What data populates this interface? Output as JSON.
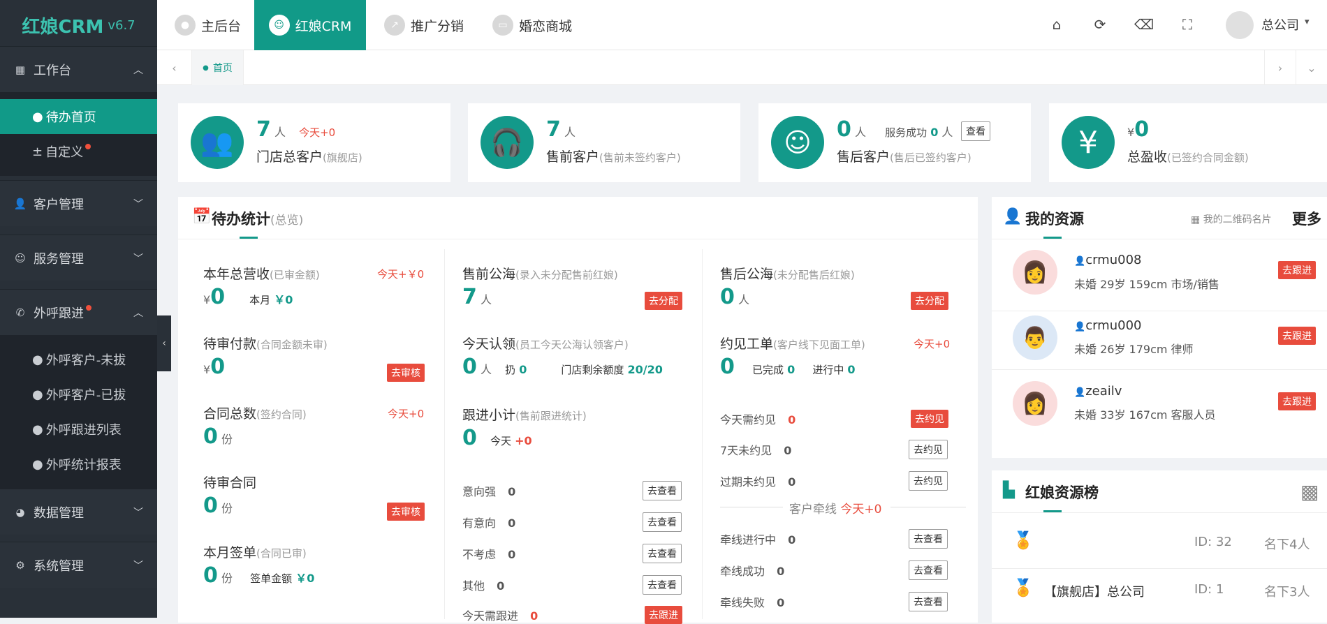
{
  "app": {
    "name": "红娘CRM",
    "version": "v6.7"
  },
  "sidebar": {
    "workbench": "工作台",
    "workbench_items": [
      "待办首页",
      "自定义"
    ],
    "customer": "客户管理",
    "service": "服务管理",
    "outcall": "外呼跟进",
    "outcall_items": [
      "外呼客户-未拔",
      "外呼客户-已拔",
      "外呼跟进列表",
      "外呼统计报表"
    ],
    "data": "数据管理",
    "system": "系统管理"
  },
  "topnav": {
    "tabs": [
      "主后台",
      "红娘CRM",
      "推广分销",
      "婚恋商城"
    ],
    "user": "总公司"
  },
  "tabstrip": {
    "home": "首页"
  },
  "kpi": [
    {
      "value": "7",
      "unit": "人",
      "today": "今天+0",
      "label": "门店总客户",
      "sub": "(旗舰店)"
    },
    {
      "value": "7",
      "unit": "人",
      "label": "售前客户",
      "sub": "(售前未签约客户)"
    },
    {
      "value": "0",
      "unit": "人",
      "success": "服务成功",
      "success_val": "0",
      "success_unit": "人",
      "btn": "查看",
      "label": "售后客户",
      "sub": "(售后已签约客户)"
    },
    {
      "currency": "¥",
      "value": "0",
      "label": "总盈收",
      "sub": "(已签约合同金额)"
    }
  ],
  "todo": {
    "title": "待办统计",
    "sub": "(总览)",
    "col1": {
      "revenue": {
        "label": "本年总营收",
        "sub": "(已审金额)",
        "today": "今天+￥0",
        "cur": "¥",
        "value": "0",
        "month": "本月",
        "month_val": "￥0"
      },
      "pending_pay": {
        "label": "待审付款",
        "sub": "(合同金额未审)",
        "cur": "¥",
        "value": "0",
        "btn": "去审核"
      },
      "contracts": {
        "label": "合同总数",
        "sub": "(签约合同)",
        "today": "今天+0",
        "value": "0",
        "unit": "份"
      },
      "pending_contract": {
        "label": "待审合同",
        "value": "0",
        "unit": "份",
        "btn": "去审核"
      },
      "month_sign": {
        "label": "本月签单",
        "sub": "(合同已审)",
        "value": "0",
        "unit": "份",
        "amount_label": "签单金额",
        "amount": "￥0"
      }
    },
    "col2": {
      "presale_sea": {
        "label": "售前公海",
        "sub": "(录入未分配售前红娘)",
        "value": "7",
        "unit": "人",
        "btn": "去分配"
      },
      "claim": {
        "label": "今天认领",
        "sub": "(员工今天公海认领客户)",
        "value": "0",
        "unit": "人",
        "reng": "扔",
        "reng_val": "0",
        "quota_label": "门店剩余额度",
        "quota": "20/20"
      },
      "follow": {
        "label": "跟进小计",
        "sub": "(售前跟进统计)",
        "value": "0",
        "today": "今天",
        "today_val": "+0"
      },
      "rows": [
        {
          "l": "意向强",
          "v": "0",
          "b": "去查看"
        },
        {
          "l": "有意向",
          "v": "0",
          "b": "去查看"
        },
        {
          "l": "不考虑",
          "v": "0",
          "b": "去查看"
        },
        {
          "l": "其他",
          "v": "0",
          "b": "去查看"
        }
      ],
      "need": {
        "l": "今天需跟进",
        "v": "0",
        "b": "去跟进"
      }
    },
    "col3": {
      "aftersale_sea": {
        "label": "售后公海",
        "sub": "(未分配售后红娘)",
        "value": "0",
        "unit": "人",
        "btn": "去分配"
      },
      "meet": {
        "label": "约见工单",
        "sub": "(客户线下见面工单)",
        "today": "今天+0",
        "value": "0",
        "done": "已完成",
        "done_val": "0",
        "ing": "进行中",
        "ing_val": "0"
      },
      "rows": [
        {
          "l": "今天需约见",
          "v": "0",
          "b": "去约见"
        },
        {
          "l": "7天未约见",
          "v": "0",
          "b": "去约见"
        },
        {
          "l": "过期未约见",
          "v": "0",
          "b": "去约见"
        }
      ],
      "divider": "客户牵线",
      "divider_today": "今天+0",
      "rows2": [
        {
          "l": "牵线进行中",
          "v": "0",
          "b": "去查看"
        },
        {
          "l": "牵线成功",
          "v": "0",
          "b": "去查看"
        },
        {
          "l": "牵线失败",
          "v": "0",
          "b": "去查看"
        }
      ]
    }
  },
  "resources": {
    "title": "我的资源",
    "qrcode": "我的二维码名片",
    "more": "更多",
    "items": [
      {
        "name": "crmu008",
        "info": "未婚 29岁 159cm 市场/销售",
        "btn": "去跟进",
        "gender": "f"
      },
      {
        "name": "crmu000",
        "info": "未婚 26岁 179cm 律师",
        "btn": "去跟进",
        "gender": "m"
      },
      {
        "name": "zeailv",
        "info": "未婚 33岁 167cm 客服人员",
        "btn": "去跟进",
        "gender": "f"
      }
    ]
  },
  "ranking": {
    "title": "红娘资源榜",
    "items": [
      {
        "name": "",
        "id_label": "ID:",
        "id": "32",
        "count": "名下4人"
      },
      {
        "name": "【旗舰店】总公司",
        "id_label": "ID:",
        "id": "1",
        "count": "名下3人"
      }
    ]
  },
  "colors": {
    "teal": "#13998a",
    "red": "#e84c3d",
    "sidebar": "#293038"
  }
}
